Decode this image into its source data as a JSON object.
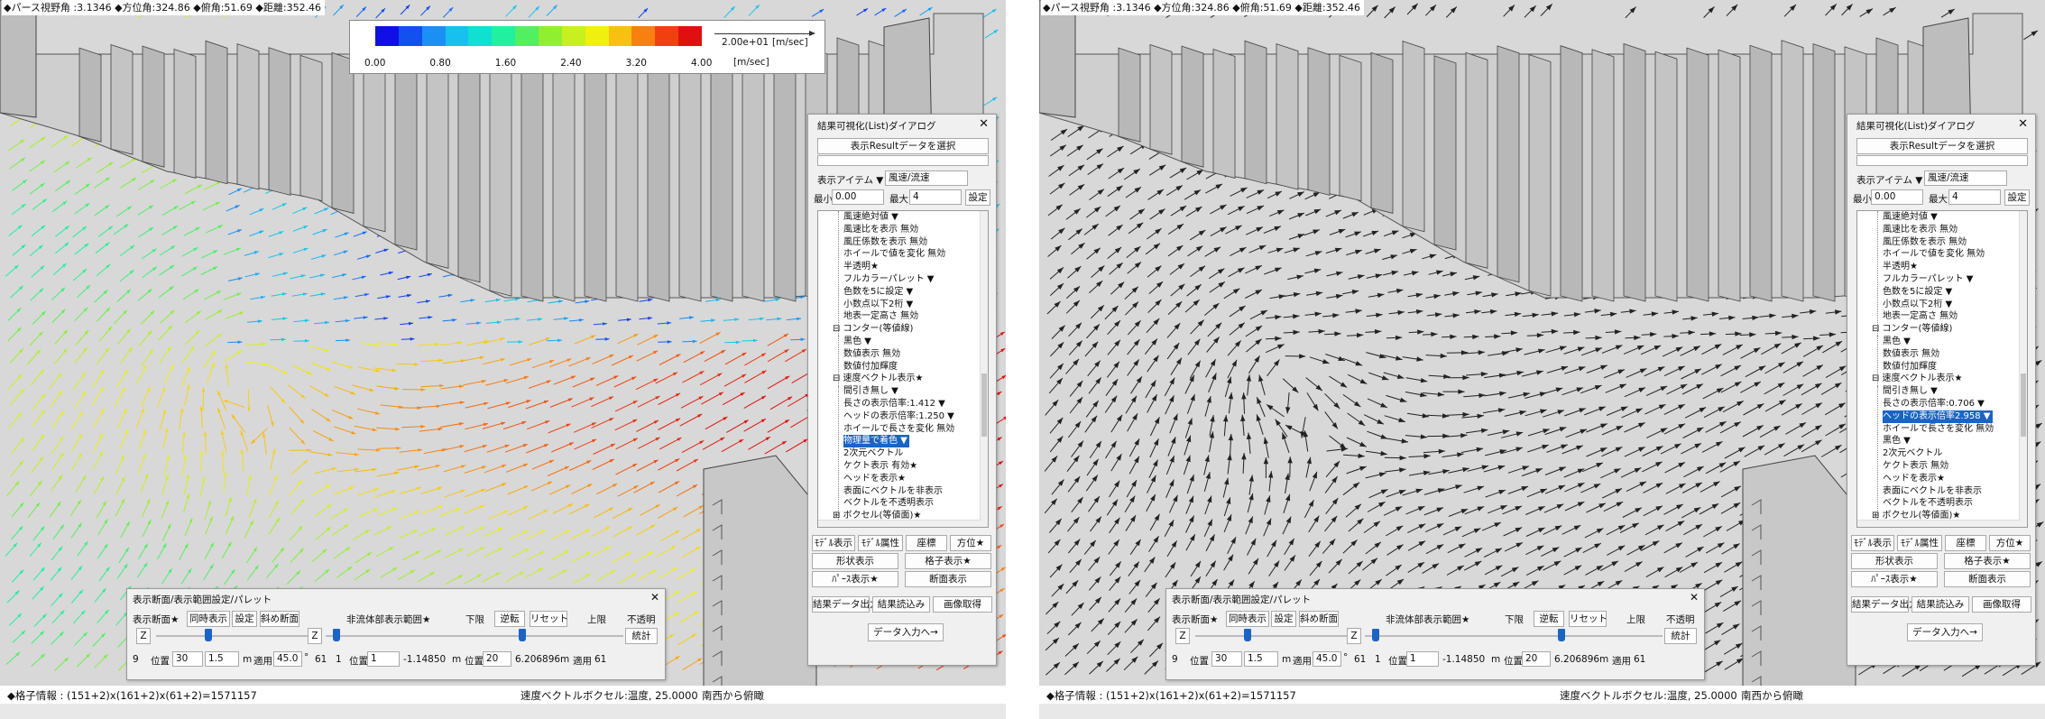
{
  "panels": [
    {
      "id": "left",
      "mode": "color",
      "top_info": "◆パース視野角 :3.1346 ◆方位角:324.86 ◆俯角:51.69 ◆距離:352.46",
      "colorbar": {
        "colors": [
          "#1010e6",
          "#1250f0",
          "#1a90f5",
          "#18c0f0",
          "#10e0d0",
          "#20f0a0",
          "#50f060",
          "#90f030",
          "#c8f020",
          "#f0f010",
          "#f8c010",
          "#f88010",
          "#f04010",
          "#e01010"
        ],
        "ticks": [
          "0.00",
          "0.80",
          "1.60",
          "2.40",
          "3.20",
          "4.00"
        ],
        "ref_value": "2.00e+01",
        "unit_top": "[m/sec]",
        "unit_bottom": "[m/sec]"
      },
      "dialog": {
        "title": "結果可視化(List)ダイアログ",
        "select_button": "表示Resultデータを選択",
        "item_label": "表示アイテム ▼",
        "item_value": "風速/流速",
        "min_label": "最小",
        "min_value": "0.00",
        "max_label": "最大",
        "max_value": "4",
        "set_button": "設定",
        "tree": [
          {
            "text": "風速絶対値 ▼",
            "indent": 2,
            "sel": false
          },
          {
            "text": "風速比を表示 無効",
            "indent": 2,
            "sel": false
          },
          {
            "text": "風圧係数を表示 無効",
            "indent": 2,
            "sel": false
          },
          {
            "text": "ホイールで値を変化 無効",
            "indent": 2,
            "sel": false
          },
          {
            "text": "半透明★",
            "indent": 2,
            "sel": false
          },
          {
            "text": "フルカラーパレット ▼",
            "indent": 2,
            "sel": false
          },
          {
            "text": "色数を5に設定 ▼",
            "indent": 2,
            "sel": false
          },
          {
            "text": "小数点以下2桁 ▼",
            "indent": 2,
            "sel": false
          },
          {
            "text": "地表一定高さ 無効",
            "indent": 2,
            "sel": false
          },
          {
            "text": "⊟ コンター(等値線)",
            "indent": 1,
            "sel": false
          },
          {
            "text": "黒色 ▼",
            "indent": 2,
            "sel": false
          },
          {
            "text": "数値表示 無効",
            "indent": 2,
            "sel": false
          },
          {
            "text": "数値付加輝度",
            "indent": 2,
            "sel": false
          },
          {
            "text": "⊟ 速度ベクトル表示★",
            "indent": 1,
            "sel": false
          },
          {
            "text": "間引き無し ▼",
            "indent": 2,
            "sel": false
          },
          {
            "text": "長さの表示倍率:1.412  ▼",
            "indent": 2,
            "sel": false
          },
          {
            "text": "ヘッドの表示倍率:1.250  ▼",
            "indent": 2,
            "sel": false
          },
          {
            "text": "ホイールで長さを変化 無効",
            "indent": 2,
            "sel": false
          },
          {
            "text": "物理量で着色 ▼",
            "indent": 2,
            "sel": true
          },
          {
            "text": "2次元ベクトル",
            "indent": 2,
            "sel": false
          },
          {
            "text": "ケクト表示 有効★",
            "indent": 2,
            "sel": false
          },
          {
            "text": "ヘッドを表示★",
            "indent": 2,
            "sel": false
          },
          {
            "text": "表面にベクトルを非表示",
            "indent": 2,
            "sel": false
          },
          {
            "text": "ベクトルを不透明表示",
            "indent": 2,
            "sel": false
          },
          {
            "text": "⊞ ボクセル(等値面)★",
            "indent": 1,
            "sel": false
          }
        ],
        "buttons_row1": [
          "ﾓﾃﾞﾙ表示",
          "ﾓﾃﾞﾙ属性",
          "座標",
          "方位★"
        ],
        "buttons_row2": [
          "形状表示",
          "格子表示★"
        ],
        "buttons_row3": [
          "ﾊﾟｰｽ表示★",
          "断面表示"
        ],
        "buttons_row4": [
          "結果データ出力",
          "結果読込み",
          "画像取得"
        ],
        "data_input_button": "データ入力へ→"
      },
      "range_panel": {
        "title": "表示断面/表示範囲設定/パレット",
        "section_label": "表示断面★",
        "sync_button": "同時表示",
        "settings_button": "設定",
        "oblique_button": "斜め断面",
        "nonfluid_label": "非流体部表示範囲★",
        "lower_label": "下限",
        "reverse_button": "逆転",
        "reset_button": "リセット",
        "upper_label": "上限",
        "opaque_label": "不透明",
        "stats_button": "統計",
        "axis_left": "Z",
        "axis_right": "Z",
        "left_index": "9",
        "pos_label": "位置",
        "pos1": "30",
        "step1": "1.5",
        "unit_m": "m",
        "apply_label": "適用",
        "apply_value": "45.0",
        "deg_label": "°",
        "apply_count": "61",
        "mid_index": "1",
        "pos2": "1",
        "pos2_value": "-1.14850",
        "pos3": "20",
        "pos3_value": "6.206896",
        "apply_count2": "61"
      },
      "bottom_left": "◆格子情報 : (151+2)x(161+2)x(61+2)=1571157",
      "bottom_mid": "速度ベクトルボクセル:温度, 25.0000",
      "bottom_right": "南西から俯瞰"
    },
    {
      "id": "right",
      "mode": "black",
      "top_info": "◆パース視野角 :3.1346 ◆方位角:324.86 ◆俯角:51.69 ◆距離:352.46",
      "dialog": {
        "title": "結果可視化(List)ダイアログ",
        "select_button": "表示Resultデータを選択",
        "item_label": "表示アイテム ▼",
        "item_value": "風速/流速",
        "min_label": "最小",
        "min_value": "0.00",
        "max_label": "最大",
        "max_value": "4",
        "set_button": "設定",
        "tree": [
          {
            "text": "風速絶対値 ▼",
            "indent": 2,
            "sel": false
          },
          {
            "text": "風速比を表示 無効",
            "indent": 2,
            "sel": false
          },
          {
            "text": "風圧係数を表示 無効",
            "indent": 2,
            "sel": false
          },
          {
            "text": "ホイールで値を変化 無効",
            "indent": 2,
            "sel": false
          },
          {
            "text": "半透明★",
            "indent": 2,
            "sel": false
          },
          {
            "text": "フルカラーパレット ▼",
            "indent": 2,
            "sel": false
          },
          {
            "text": "色数を5に設定 ▼",
            "indent": 2,
            "sel": false
          },
          {
            "text": "小数点以下2桁 ▼",
            "indent": 2,
            "sel": false
          },
          {
            "text": "地表一定高さ 無効",
            "indent": 2,
            "sel": false
          },
          {
            "text": "⊟ コンター(等値線)",
            "indent": 1,
            "sel": false
          },
          {
            "text": "黒色 ▼",
            "indent": 2,
            "sel": false
          },
          {
            "text": "数値表示 無効",
            "indent": 2,
            "sel": false
          },
          {
            "text": "数値付加輝度",
            "indent": 2,
            "sel": false
          },
          {
            "text": "⊟ 速度ベクトル表示★",
            "indent": 1,
            "sel": false
          },
          {
            "text": "間引き無し ▼",
            "indent": 2,
            "sel": false
          },
          {
            "text": "長さの表示倍率:0.706  ▼",
            "indent": 2,
            "sel": false
          },
          {
            "text": "ヘッドの表示倍率2.958 ▼",
            "indent": 2,
            "sel": true
          },
          {
            "text": "ホイールで長さを変化 無効",
            "indent": 2,
            "sel": false
          },
          {
            "text": "黒色 ▼",
            "indent": 2,
            "sel": false
          },
          {
            "text": "2次元ベクトル",
            "indent": 2,
            "sel": false
          },
          {
            "text": "ケクト表示 無効",
            "indent": 2,
            "sel": false
          },
          {
            "text": "ヘッドを表示★",
            "indent": 2,
            "sel": false
          },
          {
            "text": "表面にベクトルを非表示",
            "indent": 2,
            "sel": false
          },
          {
            "text": "ベクトルを不透明表示",
            "indent": 2,
            "sel": false
          },
          {
            "text": "⊞ ボクセル(等値面)★",
            "indent": 1,
            "sel": false
          }
        ],
        "buttons_row1": [
          "ﾓﾃﾞﾙ表示",
          "ﾓﾃﾞﾙ属性",
          "座標",
          "方位★"
        ],
        "buttons_row2": [
          "形状表示",
          "格子表示★"
        ],
        "buttons_row3": [
          "ﾊﾟｰｽ表示★",
          "断面表示"
        ],
        "buttons_row4": [
          "結果データ出力",
          "結果読込み",
          "画像取得"
        ],
        "data_input_button": "データ入力へ→"
      },
      "range_panel": {
        "title": "表示断面/表示範囲設定/パレット",
        "section_label": "表示断面★",
        "sync_button": "同時表示",
        "settings_button": "設定",
        "oblique_button": "斜め断面",
        "nonfluid_label": "非流体部表示範囲★",
        "lower_label": "下限",
        "reverse_button": "逆転",
        "reset_button": "リセット",
        "upper_label": "上限",
        "opaque_label": "不透明",
        "stats_button": "統計",
        "axis_left": "Z",
        "axis_right": "Z",
        "left_index": "9",
        "pos_label": "位置",
        "pos1": "30",
        "step1": "1.5",
        "unit_m": "m",
        "apply_label": "適用",
        "apply_value": "45.0",
        "deg_label": "°",
        "apply_count": "61",
        "mid_index": "1",
        "pos2": "1",
        "pos2_value": "-1.14850",
        "pos3": "20",
        "pos3_value": "6.206896",
        "apply_count2": "61"
      },
      "bottom_left": "◆格子情報 : (151+2)x(161+2)x(61+2)=1571157",
      "bottom_mid": "速度ベクトルボクセル:温度, 25.0000",
      "bottom_right": "南西から俯瞰"
    }
  ]
}
